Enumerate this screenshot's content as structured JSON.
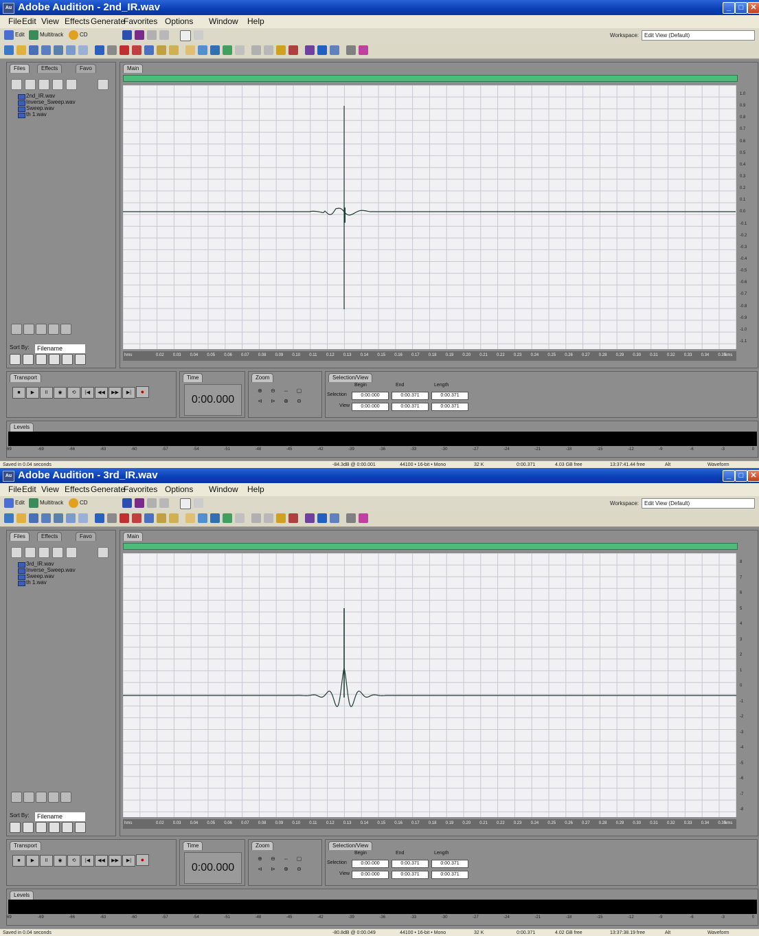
{
  "menu": [
    "File",
    "Edit",
    "View",
    "Effects",
    "Generate",
    "Favorites",
    "Options",
    "Window",
    "Help"
  ],
  "toolbar": {
    "edit_label": "Edit",
    "multitrack_label": "Multitrack",
    "cd_label": "CD",
    "workspace_label": "Workspace:",
    "workspace_value": "Edit View (Default)"
  },
  "panels": {
    "files_tab": "Files",
    "effects_tab": "Effects",
    "favorites_tab": "Favo",
    "sort_label": "Sort By:",
    "sort_value": "Filename",
    "main_tab": "Main",
    "transport_tab": "Transport",
    "time_tab": "Time",
    "zoom_tab": "Zoom",
    "selview_tab": "Selection/View",
    "levels_tab": "Levels",
    "begin_hdr": "Begin",
    "end_hdr": "End",
    "length_hdr": "Length",
    "selection_lbl": "Selection",
    "view_lbl": "View"
  },
  "time_ruler": [
    "hms",
    "0.02",
    "0.03",
    "0.04",
    "0.05",
    "0.06",
    "0.07",
    "0.08",
    "0.09",
    "0.10",
    "0.11",
    "0.12",
    "0.13",
    "0.14",
    "0.15",
    "0.16",
    "0.17",
    "0.18",
    "0.19",
    "0.20",
    "0.21",
    "0.22",
    "0.23",
    "0.24",
    "0.25",
    "0.26",
    "0.27",
    "0.28",
    "0.29",
    "0.30",
    "0.31",
    "0.32",
    "0.33",
    "0.34",
    "0.35",
    "hms"
  ],
  "level_scale": [
    "69",
    "-69",
    "-66",
    "-63",
    "-60",
    "-57",
    "-54",
    "-51",
    "-48",
    "-45",
    "-42",
    "-39",
    "-36",
    "-33",
    "-30",
    "-27",
    "-24",
    "-21",
    "-18",
    "-15",
    "-12",
    "-9",
    "-6",
    "-3",
    "0"
  ],
  "windows": [
    {
      "title": "Adobe Audition - 2nd_IR.wav",
      "files": [
        "2nd_IR.wav",
        "Inverse_Sweep.wav",
        "Sweep.wav",
        "th 1.wav"
      ],
      "amp_ruler": [
        "1.0",
        "0.9",
        "0.8",
        "0.7",
        "0.6",
        "0.5",
        "0.4",
        "0.3",
        "0.2",
        "0.1",
        "0.0",
        "-0.1",
        "-0.2",
        "-0.3",
        "-0.4",
        "-0.5",
        "-0.6",
        "-0.7",
        "-0.8",
        "-0.9",
        "-1.0",
        "-1.1"
      ],
      "time_display": "0:00.000",
      "selection": {
        "begin": "0:00.000",
        "end": "0:00.371",
        "length": "0:00.371"
      },
      "view": {
        "begin": "0:00.000",
        "end": "0:00.371",
        "length": "0:00.371"
      },
      "status": {
        "left": "Saved in 0.04 seconds",
        "cursor": "-84.3dB @  0:00.001",
        "format": "44100 • 16-bit • Mono",
        "size": "32 K",
        "duration": "0:00.371",
        "free": "4.03 GB free",
        "timefree": "13:37:41.44 free",
        "alt": "Alt",
        "mode": "Waveform"
      }
    },
    {
      "title": "Adobe Audition - 3rd_IR.wav",
      "files": [
        "3rd_IR.wav",
        "Inverse_Sweep.wav",
        "Sweep.wav",
        "th 1.wav"
      ],
      "amp_ruler": [
        "8",
        "7",
        "6",
        "5",
        "4",
        "3",
        "2",
        "1",
        "0",
        "-1",
        "-2",
        "-3",
        "-4",
        "-5",
        "-6",
        "-7",
        "-8"
      ],
      "time_display": "0:00.000",
      "selection": {
        "begin": "0:00.000",
        "end": "0:00.371",
        "length": "0:00.371"
      },
      "view": {
        "begin": "0:00.000",
        "end": "0:00.371",
        "length": "0:00.371"
      },
      "status": {
        "left": "Saved in 0.04 seconds",
        "cursor": "-80.8dB @  0:00.049",
        "format": "44100 • 16-bit • Mono",
        "size": "32 K",
        "duration": "0:00.371",
        "free": "4.02 GB free",
        "timefree": "13:37:38.19 free",
        "alt": "Alt",
        "mode": "Waveform"
      }
    }
  ]
}
